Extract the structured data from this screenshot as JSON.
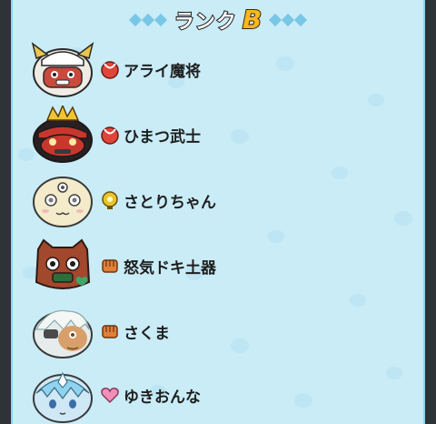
{
  "header": {
    "title": "ランク",
    "rank": "B"
  },
  "yokai": [
    {
      "name": "アライ魔将",
      "tribe_icon": "brave-horns-icon",
      "face_icon": "armored-warlord-face-icon"
    },
    {
      "name": "ひまつ武士",
      "tribe_icon": "brave-horns-icon",
      "face_icon": "samurai-crown-face-icon"
    },
    {
      "name": "さとりちゃん",
      "tribe_icon": "mysterious-bulb-icon",
      "face_icon": "three-eyed-girl-face-icon"
    },
    {
      "name": "怒気ドキ土器",
      "tribe_icon": "tough-fist-icon",
      "face_icon": "clay-pot-face-icon"
    },
    {
      "name": "さくま",
      "tribe_icon": "tough-fist-icon",
      "face_icon": "white-haired-boy-face-icon"
    },
    {
      "name": "ゆきおんな",
      "tribe_icon": "charming-heart-icon",
      "face_icon": "snow-girl-face-icon"
    }
  ],
  "colors": {
    "background": "#c9ecf7",
    "brave": "#e0453a",
    "mysterious": "#e8c52a",
    "tough": "#e0803a",
    "charming": "#f28fb9",
    "rank_badge": "#ffb81a"
  }
}
